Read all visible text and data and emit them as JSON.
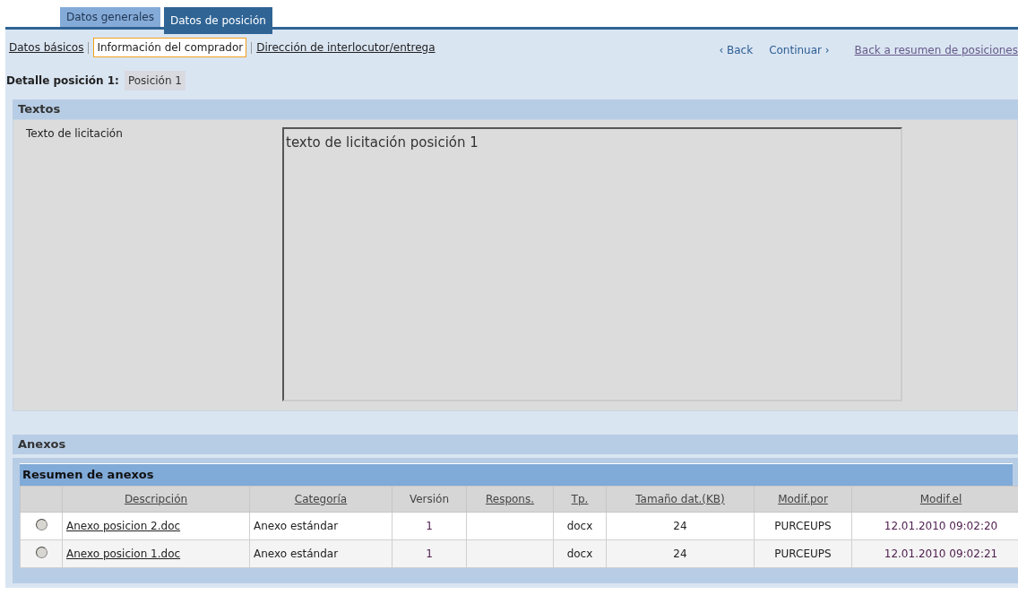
{
  "tabs": [
    {
      "label": "Datos generales",
      "selected": false
    },
    {
      "label": "Datos de posición",
      "selected": true
    }
  ],
  "subnav": [
    {
      "label": "Datos básicos",
      "selected": false
    },
    {
      "label": "Información del comprador",
      "selected": true
    },
    {
      "label": "Dirección de interlocutor/entrega",
      "selected": false
    }
  ],
  "nav": {
    "back": "‹ Back",
    "next": "Continuar ›",
    "overview": "Back a resumen de posiciones"
  },
  "detail": {
    "label": "Detalle posición 1:",
    "value": "Posición 1"
  },
  "texts_section": {
    "title": "Textos",
    "field_label": "Texto de licitación",
    "value": "texto de licitación posición 1"
  },
  "attachments_section": {
    "title": "Anexos",
    "table": {
      "title": "Resumen de anexos",
      "columns": [
        {
          "label": "Descripción",
          "sortable": true
        },
        {
          "label": "Categoría",
          "sortable": true
        },
        {
          "label": "Versión",
          "sortable": false
        },
        {
          "label": "Respons.",
          "sortable": true
        },
        {
          "label": "Tp.",
          "sortable": true
        },
        {
          "label": "Tamaño dat.(KB)",
          "sortable": true
        },
        {
          "label": "Modif.por",
          "sortable": true
        },
        {
          "label": "Modif.el",
          "sortable": true
        }
      ],
      "rows": [
        {
          "selected": false,
          "cells": [
            "Anexo posicion 2.doc",
            "Anexo estándar",
            "1",
            "",
            "docx",
            "24",
            "PURCEUPS",
            "12.01.2010 09:02:20"
          ]
        },
        {
          "selected": false,
          "cells": [
            "Anexo posicion 1.doc",
            "Anexo estándar",
            "1",
            "",
            "docx",
            "24",
            "PURCEUPS",
            "12.01.2010 09:02:21"
          ]
        }
      ]
    }
  }
}
